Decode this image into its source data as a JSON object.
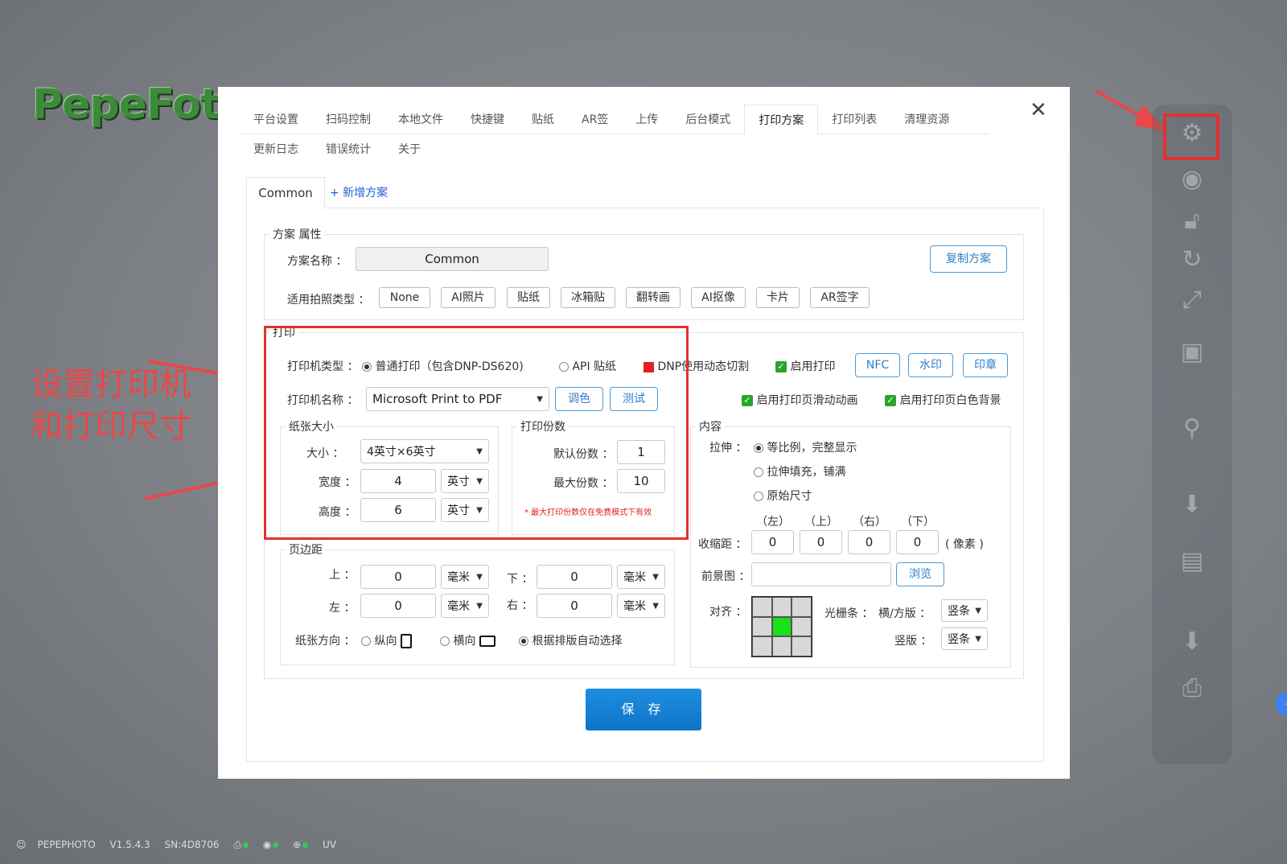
{
  "background": {
    "logo": "PepeFoto",
    "annotation_lines": [
      "设置打印机",
      "和打印尺寸"
    ],
    "right_toolbar_icons": [
      "gear-icon",
      "camera-icon",
      "unlock-icon",
      "refresh-icon",
      "expand-icon",
      "gallery-icon",
      "filter-icon",
      "download-icon",
      "layout-icon",
      "download-icon",
      "printer-icon"
    ],
    "statusbar": {
      "brand": "PEPEPHOTO",
      "version": "V1.5.4.3",
      "sn": "SN:4D8706",
      "uv": "UV"
    }
  },
  "tabs": [
    "平台设置",
    "扫码控制",
    "本地文件",
    "快捷键",
    "贴纸",
    "AR签",
    "上传",
    "后台模式",
    "打印方案",
    "打印列表",
    "清理资源"
  ],
  "active_tab": "打印方案",
  "tabs_row2": [
    "更新日志",
    "错误统计",
    "关于"
  ],
  "subtabs": {
    "common": "Common",
    "add": "+ 新增方案"
  },
  "scheme": {
    "legend": "方案 属性",
    "name_label": "方案名称 ：",
    "name_value": "Common",
    "copy_button": "复制方案",
    "types_label": "适用拍照类型 ：",
    "types": [
      "None",
      "AI照片",
      "贴纸",
      "冰箱贴",
      "翻转画",
      "AI抠像",
      "卡片",
      "AR签字"
    ]
  },
  "print": {
    "legend": "打印",
    "printer_type_label": "打印机类型 ：",
    "type_normal": "普通打印（包含DNP-DS620)",
    "type_api": "API 贴纸",
    "dnp_dynamic": "DNP使用动态切割",
    "enable_print": "启用打印",
    "btn_nfc": "NFC",
    "btn_watermark": "水印",
    "btn_stamp": "印章",
    "printer_name_label": "打印机名称 ：",
    "printer_name_value": "Microsoft Print to PDF",
    "btn_color": "调色",
    "btn_test": "测试",
    "slide_anim": "启用打印页滑动动画",
    "white_bg": "启用打印页白色背景"
  },
  "paper": {
    "legend": "纸张大小",
    "size_label": "大小 ：",
    "size_value": "4英寸×6英寸",
    "width_label": "宽度 ：",
    "width_value": "4",
    "width_unit": "英寸",
    "height_label": "高度 ：",
    "height_value": "6",
    "height_unit": "英寸"
  },
  "copies": {
    "legend": "打印份数",
    "default_label": "默认份数 ：",
    "default_value": "1",
    "max_label": "最大份数 ：",
    "max_value": "10",
    "note": "* 最大打印份数仅在免费模式下有效"
  },
  "margins": {
    "legend": "页边距",
    "top_label": "上 ：",
    "top_value": "0",
    "top_unit": "毫米",
    "bottom_label": "下 ：",
    "bottom_value": "0",
    "bottom_unit": "毫米",
    "left_label": "左 ：",
    "left_value": "0",
    "left_unit": "毫米",
    "right_label": "右 ：",
    "right_value": "0",
    "right_unit": "毫米",
    "orientation_label": "纸张方向 ：",
    "portrait": "纵向",
    "landscape": "横向",
    "auto": "根据排版自动选择"
  },
  "content": {
    "legend": "内容",
    "stretch_label": "拉伸 ：",
    "stretch_options": [
      "等比例，完整显示",
      "拉伸填充，铺满",
      "原始尺寸"
    ],
    "inset_headers": [
      "（左）",
      "（上）",
      "（右）",
      "（下）"
    ],
    "inset_label": "收缩距 ：",
    "inset_values": [
      "0",
      "0",
      "0",
      "0"
    ],
    "inset_unit": "( 像素 )",
    "foreground_label": "前景图 ：",
    "foreground_value": "",
    "browse": "浏览",
    "align_label": "对齐 ：",
    "align_selected_index": 4,
    "grating_label": "光栅条 ：",
    "grating_horiz_label": "横/方版 ：",
    "grating_horiz_value": "竖条",
    "grating_vert_label": "竖版 ：",
    "grating_vert_value": "竖条"
  },
  "save": "保 存"
}
